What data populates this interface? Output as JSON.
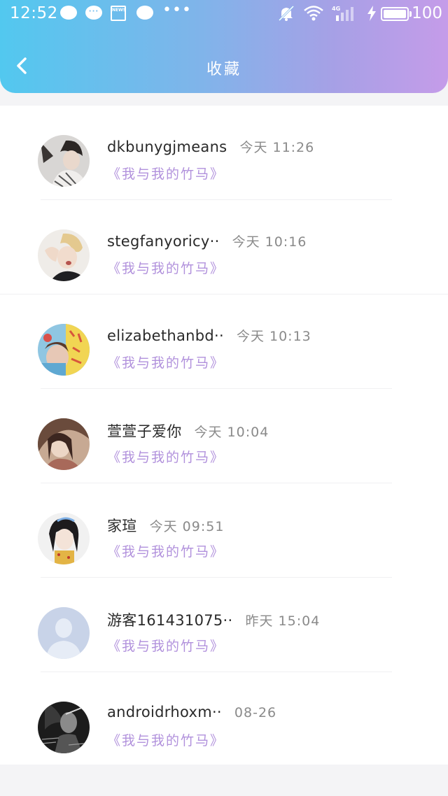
{
  "status_bar": {
    "time": "12:52",
    "news_label": "NEWS",
    "more": "•••",
    "network": "4G",
    "battery": "100"
  },
  "nav": {
    "title": "收藏"
  },
  "colors": {
    "header_gradient_start": "#52c8ef",
    "header_gradient_end": "#c59ce9",
    "book_title": "#b191dc"
  },
  "favorites": [
    {
      "name": "dkbunygjmeans",
      "time": "今天 11:26",
      "book": "《我与我的竹马》",
      "avatar": "avatar-1"
    },
    {
      "name": "stegfanyoricy··",
      "time": "今天 10:16",
      "book": "《我与我的竹马》",
      "avatar": "avatar-2"
    },
    {
      "name": "elizabethanbd··",
      "time": "今天 10:13",
      "book": "《我与我的竹马》",
      "avatar": "avatar-3"
    },
    {
      "name": "萱萱子爱你",
      "time": "今天 10:04",
      "book": "《我与我的竹马》",
      "avatar": "avatar-4"
    },
    {
      "name": "家瑄",
      "time": "今天 09:51",
      "book": "《我与我的竹马》",
      "avatar": "avatar-5"
    },
    {
      "name": "游客161431075··",
      "time": "昨天 15:04",
      "book": "《我与我的竹马》",
      "avatar": "default-avatar"
    },
    {
      "name": "androidrhoxm··",
      "time": "08-26",
      "book": "《我与我的竹马》",
      "avatar": "avatar-7"
    }
  ]
}
